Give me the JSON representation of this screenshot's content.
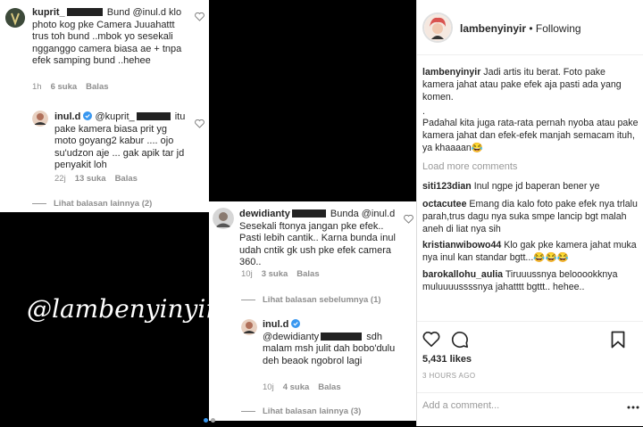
{
  "left_panel": {
    "card1": {
      "comment": {
        "username": "kuprit_",
        "text_after": " Bund @inul.d klo photo kog pke Camera Juuahattt trus toh bund ..mbok yo sesekali ngganggo camera biasa ae + tnpa efek samping bund ..hehee",
        "time": "1h",
        "likes": "6 suka",
        "reply": "Balas"
      },
      "reply": {
        "username": "inul.d",
        "text_before": " @kuprit_",
        "text_after": " itu pake kamera biasa prit yg moto goyang2 kabur .... ojo su'udzon aje ... gak apik tar jd penyakit loh",
        "time": "22j",
        "likes": "13 suka",
        "reply": "Balas"
      },
      "view_replies": "Lihat balasan lainnya (2)"
    },
    "card2": {
      "comment": {
        "username": "dewidianty",
        "text_after": " Bunda @inul.d Sesekali ftonya jangan pke efek.. Pasti lebih cantik.. Karna bunda inul udah cntik gk ush pke efek camera 360..",
        "time": "10j",
        "likes": "3 suka",
        "reply": "Balas"
      },
      "view_prev": "Lihat balasan sebelumnya (1)",
      "reply": {
        "username": "inul.d",
        "text_before": " @dewidianty",
        "text_after": " sdh malam msh julit dah bobo'dulu deh beaok ngobrol lagi",
        "time": "10j",
        "likes": "4 suka",
        "reply": "Balas"
      },
      "view_replies": "Lihat balasan lainnya (3)"
    },
    "watermark": "@lambenyinyir"
  },
  "right_panel": {
    "header": {
      "username": "lambenyinyir",
      "separator": " • ",
      "follow_status": "Following"
    },
    "caption": {
      "username": "lambenyinyir",
      "line1": " Jadi artis itu berat. Foto pake kamera jahat atau pake efek aja pasti ada yang komen.",
      "line2": ".",
      "line3": "Padahal kita juga rata-rata pernah nyoba atau pake kamera jahat dan efek-efek manjah semacam ituh, ya khaaaan😂"
    },
    "load_more": "Load more comments",
    "comments": [
      {
        "username": "siti123dian",
        "text": " Inul ngpe jd baperan bener ye"
      },
      {
        "username": "octacutee",
        "text": " Emang dia kalo foto pake efek nya trlalu parah,trus dagu nya suka smpe lancip bgt malah aneh di liat nya sih"
      },
      {
        "username": "kristianwibowo44",
        "text": " Klo gak pke kamera jahat muka nya inul kan standar bgtt...😂😂😂"
      },
      {
        "username": "barokallohu_aulia",
        "text": " Tiruuussnya belooookknya muluuuussssnya jahatttt bgttt.. hehee.."
      }
    ],
    "likes": "5,431 likes",
    "time": "3 HOURS AGO",
    "add_comment_placeholder": "Add a comment..."
  },
  "colors": {
    "link_blue": "#3897f0",
    "muted_gray": "#8e8e8e",
    "text": "#262626",
    "avatar_red": "#d9534f"
  }
}
